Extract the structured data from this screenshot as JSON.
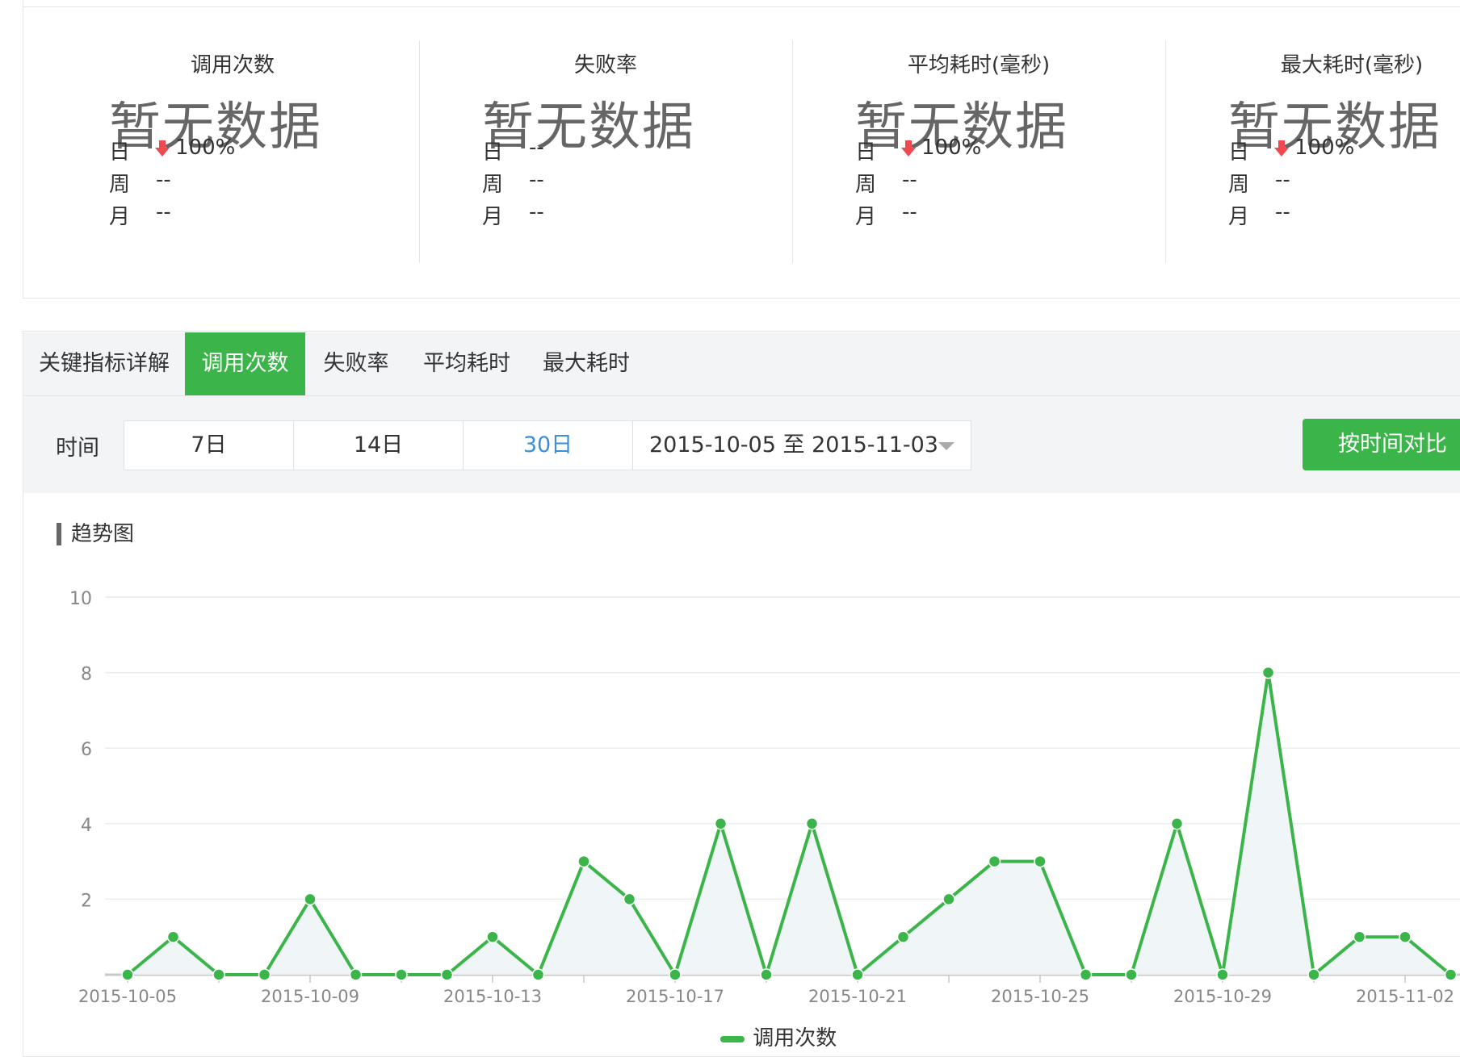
{
  "metrics": [
    {
      "title": "调用次数",
      "value": "暂无数据",
      "day_label": "日",
      "day": "100%",
      "day_down": true,
      "week_label": "周",
      "week": "--",
      "month_label": "月",
      "month": "--"
    },
    {
      "title": "失败率",
      "value": "暂无数据",
      "day_label": "日",
      "day": "--",
      "day_down": false,
      "week_label": "周",
      "week": "--",
      "month_label": "月",
      "month": "--"
    },
    {
      "title": "平均耗时(毫秒)",
      "value": "暂无数据",
      "day_label": "日",
      "day": "100%",
      "day_down": true,
      "week_label": "周",
      "week": "--",
      "month_label": "月",
      "month": "--"
    },
    {
      "title": "最大耗时(毫秒)",
      "value": "暂无数据",
      "day_label": "日",
      "day": "100%",
      "day_down": true,
      "week_label": "周",
      "week": "--",
      "month_label": "月",
      "month": "--"
    }
  ],
  "tabs": {
    "header": "关键指标详解",
    "items": [
      "调用次数",
      "失败率",
      "平均耗时",
      "最大耗时"
    ],
    "active": "调用次数"
  },
  "filter": {
    "time_label": "时间",
    "ranges": [
      "7日",
      "14日",
      "30日"
    ],
    "active_range": "30日",
    "date_range": "2015-10-05 至 2015-11-03",
    "compare_button": "按时间对比"
  },
  "section_title": "趋势图",
  "colors": {
    "accent": "#3bb54a",
    "down_arrow": "#f0494f",
    "link": "#3a8fdc"
  },
  "chart_data": {
    "type": "area",
    "x": [
      "2015-10-05",
      "2015-10-06",
      "2015-10-07",
      "2015-10-08",
      "2015-10-09",
      "2015-10-10",
      "2015-10-11",
      "2015-10-12",
      "2015-10-13",
      "2015-10-14",
      "2015-10-15",
      "2015-10-16",
      "2015-10-17",
      "2015-10-18",
      "2015-10-19",
      "2015-10-20",
      "2015-10-21",
      "2015-10-22",
      "2015-10-23",
      "2015-10-24",
      "2015-10-25",
      "2015-10-26",
      "2015-10-27",
      "2015-10-28",
      "2015-10-29",
      "2015-10-30",
      "2015-10-31",
      "2015-11-01",
      "2015-11-02",
      "2015-11-03"
    ],
    "tick_labels": [
      "2015-10-05",
      "2015-10-09",
      "2015-10-13",
      "2015-10-17",
      "2015-10-21",
      "2015-10-25",
      "2015-10-29",
      "2015-11-02"
    ],
    "series": [
      {
        "name": "调用次数",
        "values": [
          0,
          1,
          0,
          0,
          2,
          0,
          0,
          0,
          1,
          0,
          3,
          2,
          0,
          4,
          0,
          4,
          0,
          1,
          2,
          3,
          3,
          0,
          0,
          4,
          0,
          8,
          0,
          1,
          1,
          0
        ]
      }
    ],
    "yticks": [
      2,
      4,
      6,
      8,
      10
    ],
    "ylim": [
      0,
      10
    ],
    "grid": true,
    "legend": "bottom"
  }
}
